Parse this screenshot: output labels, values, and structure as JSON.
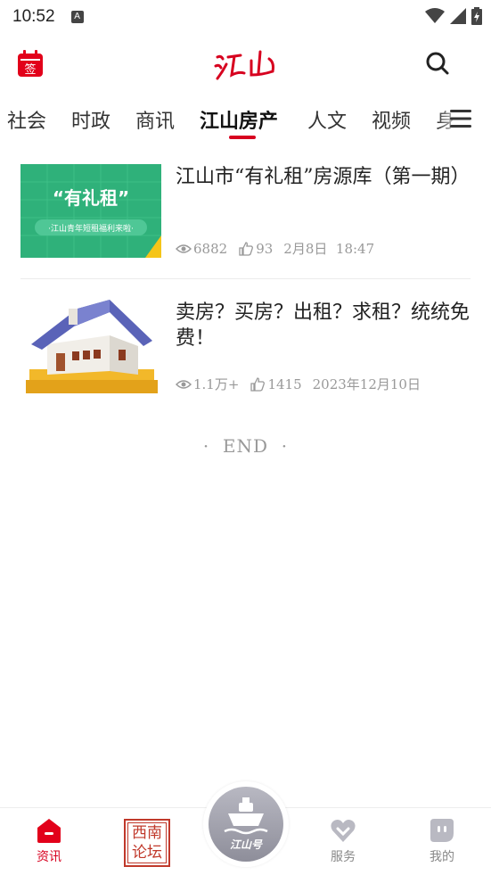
{
  "status_bar": {
    "time": "10:52",
    "a_badge": "A"
  },
  "header": {
    "checkin_label": "签",
    "logo_text": "江山"
  },
  "tabs": [
    {
      "label": "社会"
    },
    {
      "label": "时政"
    },
    {
      "label": "商讯"
    },
    {
      "label": "江山房产",
      "active": true
    },
    {
      "label": "人文"
    },
    {
      "label": "视频"
    },
    {
      "label": "身"
    }
  ],
  "news": [
    {
      "title": "江山市“有礼租”房源库（第一期）",
      "thumb_main": "“有礼租”",
      "thumb_sub": "·江山青年短租福利来啦·",
      "views": "6882",
      "likes": "93",
      "date": "2月8日  18:47"
    },
    {
      "title": "卖房？买房？出租？求租？统统免费！",
      "views": "1.1万+",
      "likes": "1415",
      "date": "2023年12月10日"
    }
  ],
  "end_text": "·  END  ·",
  "bottom_nav": {
    "news": "资讯",
    "forum_line1": "西南",
    "forum_line2": "论坛",
    "center": "江山号",
    "service": "服务",
    "mine": "我的"
  },
  "colors": {
    "accent": "#d7001f",
    "thumb_green": "#2fb17a"
  }
}
